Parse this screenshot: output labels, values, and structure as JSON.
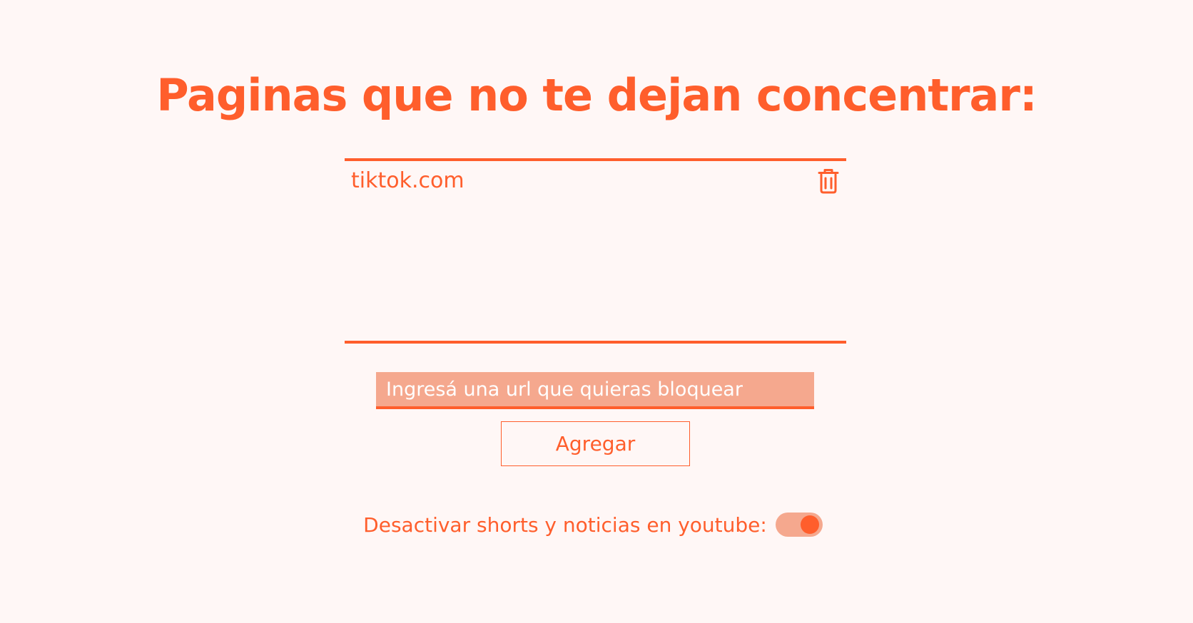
{
  "header": {
    "title": "Paginas que no te dejan concentrar:"
  },
  "blocked_list": {
    "items": [
      {
        "label": "tiktok.com",
        "action_icon": "trash-icon"
      }
    ]
  },
  "add_form": {
    "input_placeholder": "Ingresá una url que quieras bloquear",
    "input_value": "",
    "button_label": "Agregar"
  },
  "youtube_option": {
    "label": "Desactivar shorts y noticias en youtube:",
    "enabled": true
  },
  "colors": {
    "accent": "#ff5e2c",
    "accent_light": "#f5a88e",
    "background": "#fff7f6"
  }
}
